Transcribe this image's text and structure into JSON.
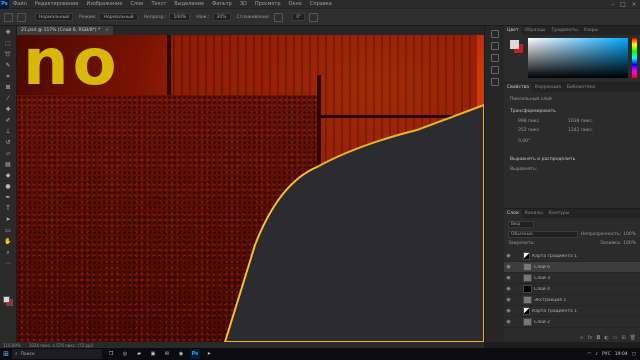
{
  "app": {
    "logo": "Ps",
    "menu": [
      "Файл",
      "Редактирование",
      "Изображение",
      "Слои",
      "Текст",
      "Выделение",
      "Фильтр",
      "3D",
      "Просмотр",
      "Окно",
      "Справка"
    ]
  },
  "options_bar": {
    "tool_preset": "Нормальный",
    "mode_label": "Режим:",
    "mode_value": "Нормальный",
    "opacity_label": "Непрозр.:",
    "opacity_value": "100%",
    "flow_label": "Наж.:",
    "flow_value": "30%",
    "smoothing_label": "Сглаживание:",
    "angle_value": "0°"
  },
  "document": {
    "tab_title": "21.psd @ 117% (Слой 6, RGB/8*) *",
    "tab_close": "×",
    "canvas_text": "no"
  },
  "status": {
    "zoom": "116,89%",
    "doc_size": "1024 пикс. x 576 пикс. (72 ppi)"
  },
  "color_panel": {
    "tabs": [
      "Цвет",
      "Образцы",
      "Градиенты",
      "Узоры"
    ]
  },
  "properties_panel": {
    "tabs": [
      "Свойства",
      "Коррекция",
      "Библиотеки"
    ],
    "layer_kind": "Пиксельный слой",
    "section_transform": "Трансформировать",
    "w_value": "998 пикс.",
    "x_value": "1038 пикс.",
    "h_value": "352 пикс.",
    "y_value": "1342 пикс.",
    "angle_value": "0,00°",
    "section_align": "Выровнять и распределить",
    "align_label": "Выровнять:"
  },
  "layers_panel": {
    "tabs": [
      "Слои",
      "Каналы",
      "Контуры"
    ],
    "filter_kind": "Вид",
    "blend_mode": "Обычные",
    "opacity_label": "Непрозрачность:",
    "opacity_value": "100%",
    "lock_label": "Закрепить:",
    "fill_label": "Заливка:",
    "fill_value": "100%",
    "layers": [
      {
        "name": "Карта градиента 1",
        "thumb": "adj",
        "selected": false
      },
      {
        "name": "Слой 6",
        "thumb": "gray",
        "selected": true
      },
      {
        "name": "Слой 3",
        "thumb": "gray",
        "selected": false
      },
      {
        "name": "Слой 4",
        "thumb": "black",
        "selected": false
      },
      {
        "name": "Экстракция 1",
        "thumb": "gray",
        "selected": false
      },
      {
        "name": "Карта градиента 1",
        "thumb": "adj",
        "selected": false
      },
      {
        "name": "Слой 2",
        "thumb": "gray",
        "selected": false
      },
      {
        "name": "Слой 1",
        "thumb": "black",
        "selected": false
      },
      {
        "name": "Эффекты",
        "thumb": "none",
        "selected": false
      }
    ]
  },
  "taskbar": {
    "search_placeholder": "Поиск",
    "lang": "РУС",
    "time": "19:04"
  }
}
